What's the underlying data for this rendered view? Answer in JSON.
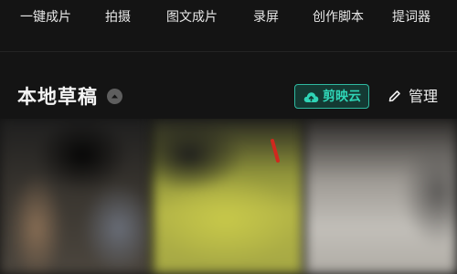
{
  "toolbar": {
    "items": [
      {
        "label": "一键成片"
      },
      {
        "label": "拍摄"
      },
      {
        "label": "图文成片"
      },
      {
        "label": "录屏"
      },
      {
        "label": "创作脚本"
      },
      {
        "label": "提词器"
      }
    ]
  },
  "drafts": {
    "title": "本地草稿",
    "collapse_icon": "chevron-up-icon",
    "cloud_button": {
      "label": "剪映云",
      "icon": "cloud-upload-icon"
    },
    "manage_button": {
      "label": "管理",
      "icon": "pencil-icon"
    },
    "items": [
      {},
      {},
      {}
    ]
  },
  "colors": {
    "background": "#141414",
    "accent": "#2fd4b6"
  }
}
